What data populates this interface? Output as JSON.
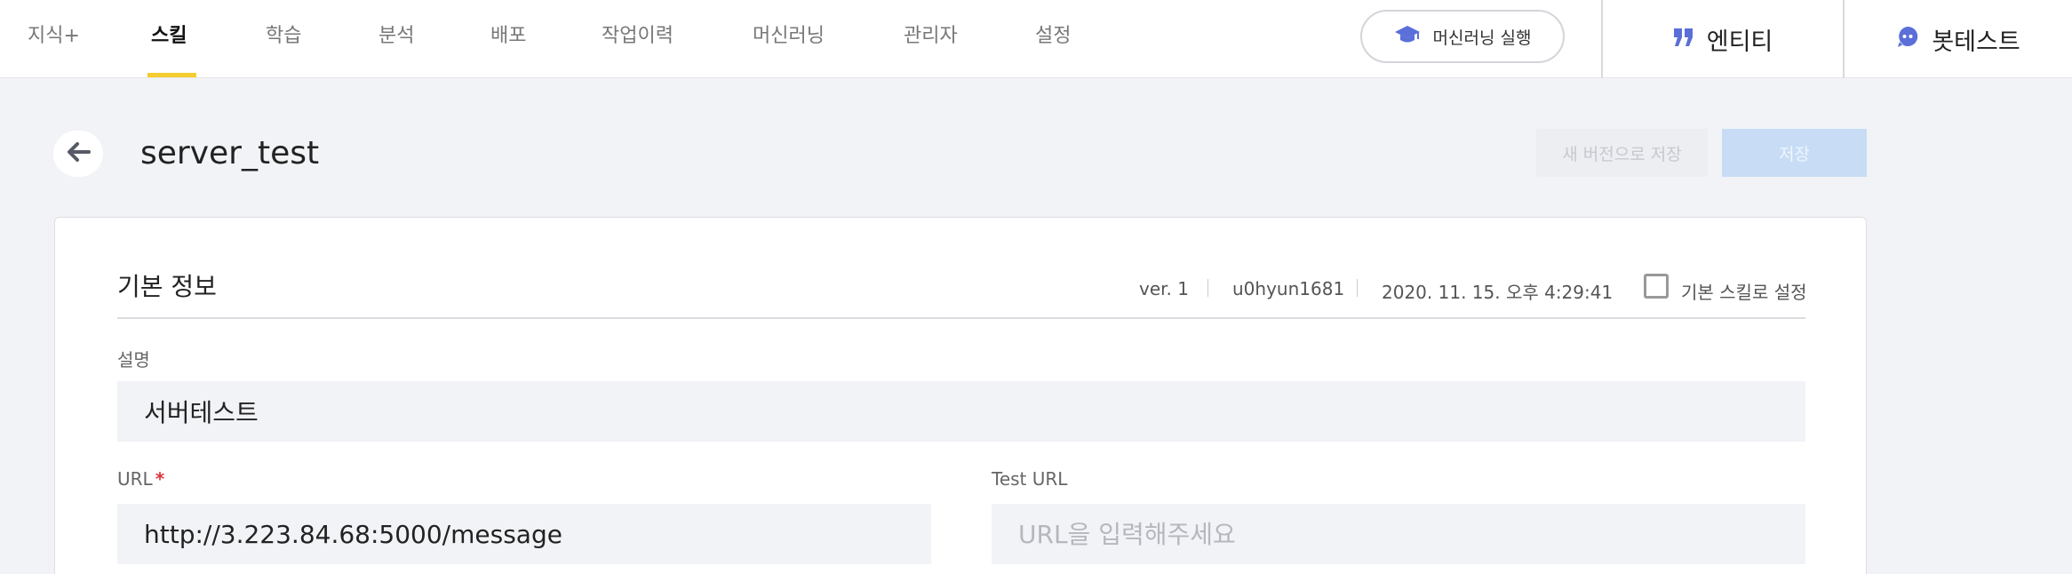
{
  "nav": {
    "items": [
      {
        "label": "지식+"
      },
      {
        "label": "스킬"
      },
      {
        "label": "학습"
      },
      {
        "label": "분석"
      },
      {
        "label": "배포"
      },
      {
        "label": "작업이력"
      },
      {
        "label": "머신러닝"
      },
      {
        "label": "관리자"
      },
      {
        "label": "설정"
      }
    ],
    "active": "스킬",
    "accent_color": "#f5cd2e"
  },
  "topbar": {
    "ml_run_label": "머신러닝 실행",
    "ml_run_icon": "graduation-cap-icon",
    "entity_label": "엔티티",
    "entity_icon": "quote-icon",
    "bottest_label": "봇테스트",
    "bottest_icon": "chat-bot-icon",
    "icon_color": "#5b6fd8"
  },
  "page": {
    "title": "server_test",
    "back_icon": "arrow-left-icon",
    "save_new_version_label": "새 버전으로 저장",
    "save_label": "저장"
  },
  "basic_info": {
    "title": "기본 정보",
    "version": "ver. 1",
    "author": "u0hyun1681",
    "date": "2020. 11. 15. 오후 4:29:41",
    "default_skill_label": "기본 스킬로 설정",
    "default_skill_checked": false
  },
  "form": {
    "description": {
      "label": "설명",
      "value": "서버테스트"
    },
    "url": {
      "label": "URL",
      "required_mark": "*",
      "value": "http://3.223.84.68:5000/message"
    },
    "test_url": {
      "label": "Test URL",
      "value": "",
      "placeholder": "URL을 입력해주세요"
    }
  }
}
